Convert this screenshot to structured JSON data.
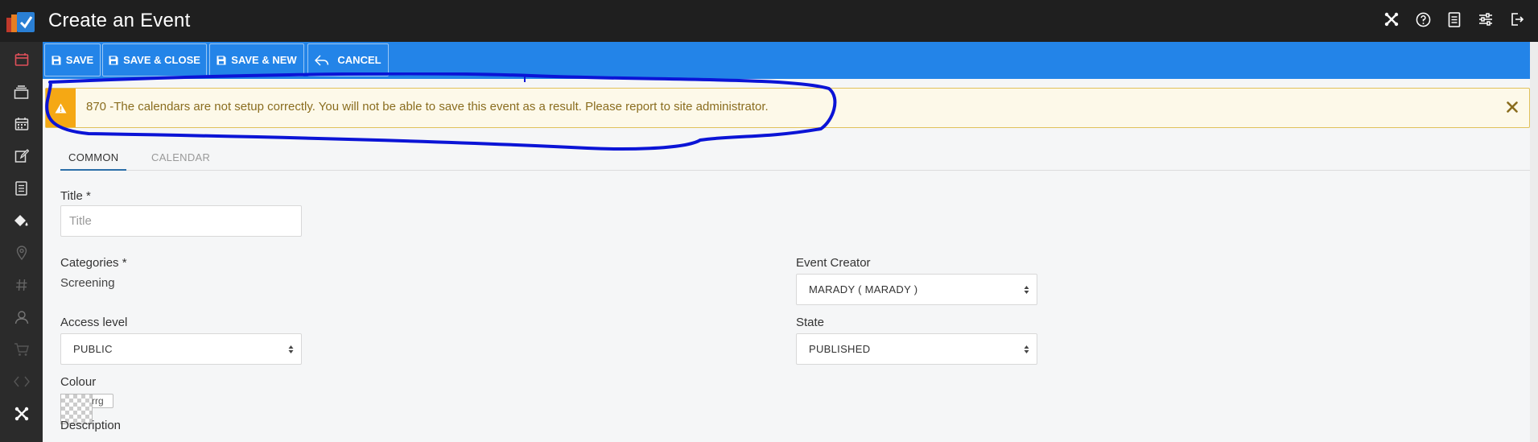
{
  "header": {
    "title": "Create an Event",
    "icons": [
      "joomla-icon",
      "help-icon",
      "document-icon",
      "sliders-icon",
      "logout-icon"
    ]
  },
  "sidebar": {
    "items": [
      "calendar-icon",
      "stack-icon",
      "calendar-list-icon",
      "edit-icon",
      "document-icon",
      "paint-bucket-icon",
      "map-pin-icon",
      "hash-icon",
      "user-icon",
      "cart-icon",
      "code-icon",
      "joomla-icon"
    ]
  },
  "toolbar": {
    "save_label": "SAVE",
    "save_close_label": "SAVE & CLOSE",
    "save_new_label": "SAVE & NEW",
    "cancel_label": "CANCEL"
  },
  "alert": {
    "message": "870 -The calendars are not setup correctly. You will not be able to save this event as a result. Please report to site administrator."
  },
  "tabs": [
    {
      "label": "COMMON",
      "active": true
    },
    {
      "label": "CALENDAR",
      "active": false
    }
  ],
  "form": {
    "title_label": "Title *",
    "title_placeholder": "Title",
    "categories_label": "Categories *",
    "categories_value": "Screening",
    "event_creator_label": "Event Creator",
    "event_creator_value": "MARADY ( MARADY )",
    "access_label": "Access level",
    "access_value": "PUBLIC",
    "state_label": "State",
    "state_value": "PUBLISHED",
    "colour_label": "Colour",
    "colour_value": "rrg",
    "description_label": "Description"
  },
  "colors": {
    "topbar": "#1f1f1f",
    "sidebar": "#2b2b2b",
    "toolbar": "#2384e8",
    "alert_bg": "#fdf9e9",
    "alert_accent": "#f5a814",
    "alert_text": "#8a6d1f",
    "annotation": "#0b14d6"
  }
}
